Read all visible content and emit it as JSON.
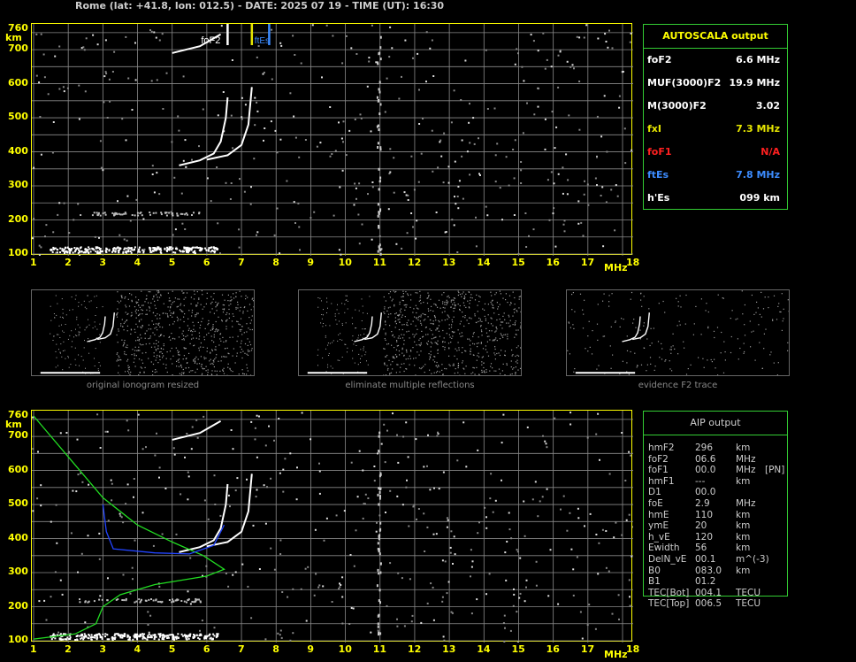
{
  "header": "Rome (lat: +41.8, lon: 012.5) - DATE: 2025 07 19 - TIME (UT): 16:30",
  "axes": {
    "y_ticks": [
      "760",
      "700",
      "600",
      "500",
      "400",
      "300",
      "200",
      "100"
    ],
    "x_ticks": [
      "1",
      "2",
      "3",
      "4",
      "5",
      "6",
      "7",
      "8",
      "9",
      "10",
      "11",
      "12",
      "13",
      "14",
      "15",
      "16",
      "17",
      "18"
    ],
    "y_unit": "km",
    "x_unit": "MHz"
  },
  "markers": {
    "fof2": "foF2",
    "ftes": "ftEs",
    "fxl": "fxI"
  },
  "autoscala": {
    "title": "AUTOSCALA output",
    "rows": [
      {
        "key": "foF2",
        "val": "6.6 MHz",
        "color": "#ffffff"
      },
      {
        "key": "MUF(3000)F2",
        "val": "19.9 MHz",
        "color": "#ffffff"
      },
      {
        "key": "M(3000)F2",
        "val": "3.02",
        "color": "#ffffff"
      },
      {
        "key": "fxI",
        "val": "7.3 MHz",
        "color": "#e6e600"
      },
      {
        "key": "foF1",
        "val": "N/A",
        "color": "#ff2020"
      },
      {
        "key": "ftEs",
        "val": "7.8 MHz",
        "color": "#3c8cff"
      },
      {
        "key": "h'Es",
        "val": "099    km",
        "color": "#ffffff"
      }
    ]
  },
  "thumbnails": [
    {
      "caption": "original ionogram resized"
    },
    {
      "caption": "eliminate multiple reflections"
    },
    {
      "caption": "evidence F2 trace"
    }
  ],
  "aip": {
    "title": "AIP output",
    "rows": [
      {
        "k": "hmF2",
        "v": "296",
        "u": "km",
        "x": ""
      },
      {
        "k": "foF2",
        "v": "06.6",
        "u": "MHz",
        "x": ""
      },
      {
        "k": "foF1",
        "v": "00.0",
        "u": "MHz",
        "x": "[PN]"
      },
      {
        "k": "hmF1",
        "v": "---",
        "u": "km",
        "x": ""
      },
      {
        "k": "D1",
        "v": "00.0",
        "u": "",
        "x": ""
      },
      {
        "k": "foE",
        "v": "2.9",
        "u": "MHz",
        "x": ""
      },
      {
        "k": "hmE",
        "v": "110",
        "u": "km",
        "x": ""
      },
      {
        "k": "ymE",
        "v": "20",
        "u": "km",
        "x": ""
      },
      {
        "k": "h_vE",
        "v": "120",
        "u": "km",
        "x": ""
      },
      {
        "k": "Ewidth",
        "v": "56",
        "u": "km",
        "x": ""
      },
      {
        "k": "DelN_vE",
        "v": "00.1",
        "u": "m^(-3)",
        "x": ""
      },
      {
        "k": "B0",
        "v": "083.0",
        "u": "km",
        "x": ""
      },
      {
        "k": "B1",
        "v": "01.2",
        "u": "",
        "x": ""
      },
      {
        "k": "TEC[Bot]",
        "v": "004.1",
        "u": "TECU",
        "x": ""
      },
      {
        "k": "TEC[Top]",
        "v": "006.5",
        "u": "TECU",
        "x": ""
      }
    ]
  },
  "chart_data": [
    {
      "type": "scatter",
      "name": "autoscala ionogram",
      "x_range": [
        1,
        18
      ],
      "y_range": [
        100,
        760
      ],
      "ylabel": "km",
      "xlabel": "MHz",
      "grid": true,
      "series": [
        {
          "name": "Es trace",
          "points": [
            [
              1.5,
              112
            ],
            [
              2.5,
              114
            ],
            [
              3.5,
              116
            ],
            [
              4.5,
              117
            ],
            [
              5.5,
              116
            ],
            [
              6.3,
              114
            ]
          ]
        },
        {
          "name": "F2 o-trace",
          "points": [
            [
              5.2,
              360
            ],
            [
              5.8,
              375
            ],
            [
              6.2,
              395
            ],
            [
              6.4,
              430
            ],
            [
              6.55,
              500
            ],
            [
              6.6,
              560
            ]
          ]
        },
        {
          "name": "F2 x-trace",
          "points": [
            [
              6.0,
              377
            ],
            [
              6.6,
              390
            ],
            [
              7.0,
              420
            ],
            [
              7.2,
              480
            ],
            [
              7.3,
              590
            ]
          ]
        }
      ],
      "markers": [
        {
          "label": "foF2",
          "x": 6.6
        },
        {
          "label": "ftEs",
          "x": 7.8
        },
        {
          "label": "fxI",
          "x": 7.3
        }
      ]
    },
    {
      "type": "line",
      "name": "aip profile",
      "x_range": [
        1,
        18
      ],
      "y_range": [
        100,
        760
      ],
      "series": [
        {
          "name": "green profile",
          "points": [
            [
              1.0,
              760
            ],
            [
              2.0,
              640
            ],
            [
              3.0,
              520
            ],
            [
              4.0,
              440
            ],
            [
              5.0,
              390
            ],
            [
              5.9,
              350
            ],
            [
              6.5,
              310
            ],
            [
              6.0,
              290
            ],
            [
              4.5,
              265
            ],
            [
              3.5,
              235
            ],
            [
              3.0,
              200
            ],
            [
              2.8,
              150
            ],
            [
              2.2,
              120
            ],
            [
              1.0,
              105
            ]
          ]
        },
        {
          "name": "blue profile",
          "points": [
            [
              3.0,
              500
            ],
            [
              3.1,
              420
            ],
            [
              3.3,
              370
            ],
            [
              4.5,
              358
            ],
            [
              5.5,
              355
            ],
            [
              6.2,
              380
            ],
            [
              6.5,
              440
            ]
          ]
        }
      ]
    }
  ]
}
